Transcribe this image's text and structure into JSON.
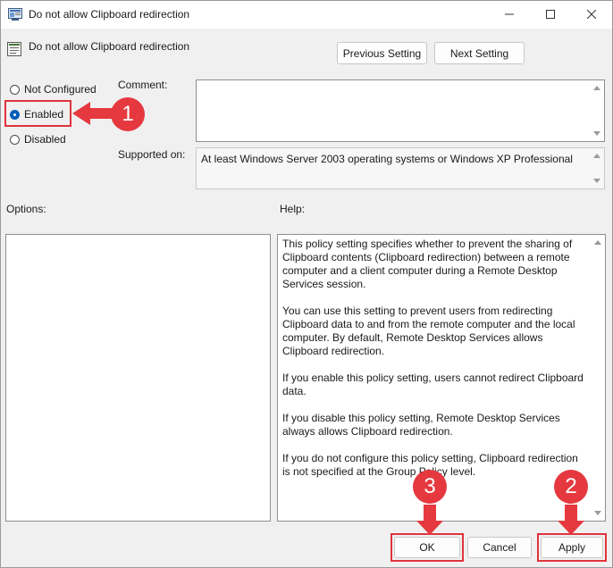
{
  "window": {
    "title": "Do not allow Clipboard redirection",
    "icons": {
      "app": "group-policy-icon",
      "minimize": "minimize-icon",
      "maximize": "maximize-icon",
      "close": "close-icon"
    }
  },
  "header": {
    "policy_title": "Do not allow Clipboard redirection",
    "previous_label": "Previous Setting",
    "next_label": "Next Setting"
  },
  "state": {
    "options": [
      {
        "label": "Not Configured",
        "checked": false
      },
      {
        "label": "Enabled",
        "checked": true
      },
      {
        "label": "Disabled",
        "checked": false
      }
    ]
  },
  "comment": {
    "label": "Comment:",
    "value": ""
  },
  "supported": {
    "label": "Supported on:",
    "value": "At least Windows Server 2003 operating systems or Windows XP Professional"
  },
  "options_panel": {
    "label": "Options:"
  },
  "help_panel": {
    "label": "Help:",
    "paragraphs": [
      "This policy setting specifies whether to prevent the sharing of Clipboard contents (Clipboard redirection) between a remote computer and a client computer during a Remote Desktop Services session.",
      "You can use this setting to prevent users from redirecting Clipboard data to and from the remote computer and the local computer. By default, Remote Desktop Services allows Clipboard redirection.",
      "If you enable this policy setting, users cannot redirect Clipboard data.",
      "If you disable this policy setting, Remote Desktop Services always allows Clipboard redirection.",
      "If you do not configure this policy setting, Clipboard redirection is not specified at the Group Policy level."
    ]
  },
  "footer": {
    "ok_label": "OK",
    "cancel_label": "Cancel",
    "apply_label": "Apply"
  },
  "annotations": {
    "step_1": "1",
    "step_2": "2",
    "step_3": "3",
    "color": "#e5393f"
  }
}
